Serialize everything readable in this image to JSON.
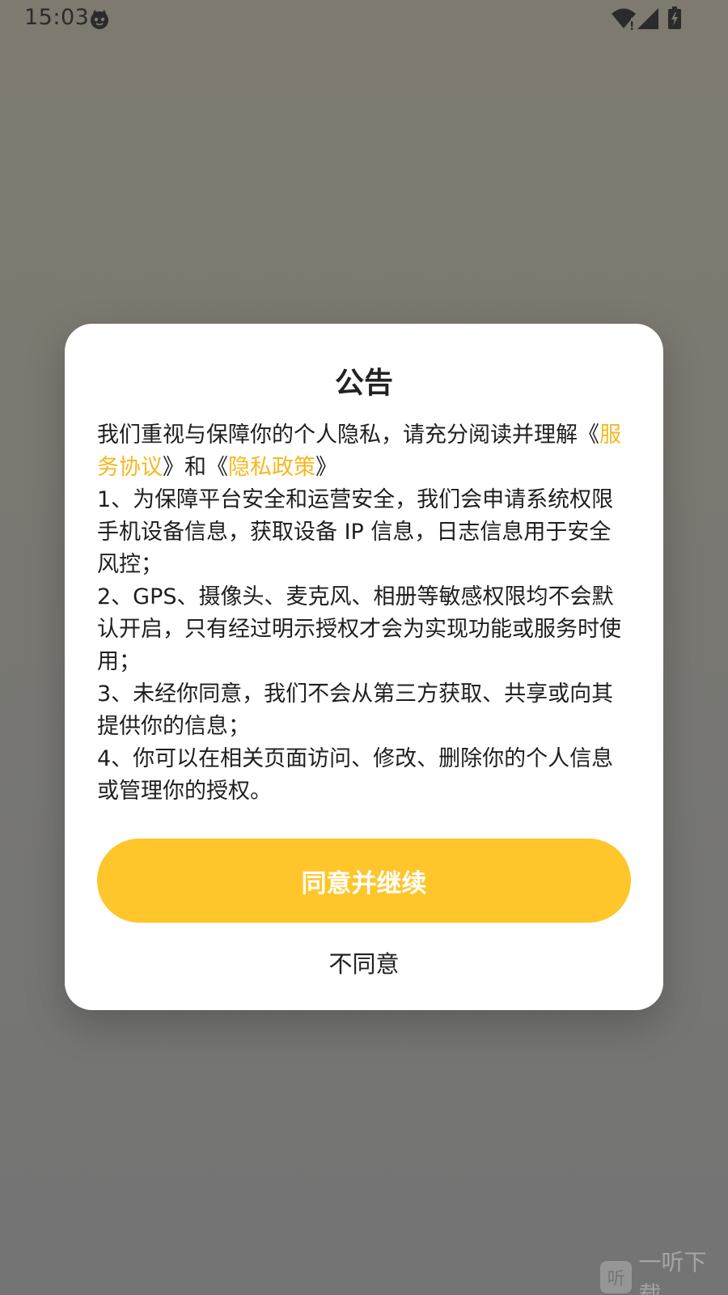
{
  "status_bar": {
    "time": "15:03",
    "icons": [
      "cat-icon",
      "wifi-icon",
      "signal-icon",
      "battery-icon"
    ]
  },
  "dialog": {
    "title": "公告",
    "intro_prefix": "我们重视与保障你的个人隐私，请充分阅读并理解",
    "bracket_open": "《",
    "bracket_close": "》",
    "service_link": "服务协议",
    "and_text": "和",
    "privacy_link": "隐私政策",
    "items": [
      "1、为保障平台安全和运营安全，我们会申请系统权限手机设备信息，获取设备 IP 信息，日志信息用于安全风控；",
      "2、GPS、摄像头、麦克风、相册等敏感权限均不会默认开启，只有经过明示授权才会为实现功能或服务时使用；",
      "3、未经你同意，我们不会从第三方获取、共享或向其提供你的信息；",
      "4、你可以在相关页面访问、修改、删除你的个人信息或管理你的授权。"
    ],
    "agree_label": "同意并继续",
    "disagree_label": "不同意"
  },
  "watermark": {
    "badge": "听",
    "text": "一听下载"
  },
  "colors": {
    "accent": "#ffc62b",
    "link": "#f6b821",
    "dialog_bg": "#ffffff"
  }
}
